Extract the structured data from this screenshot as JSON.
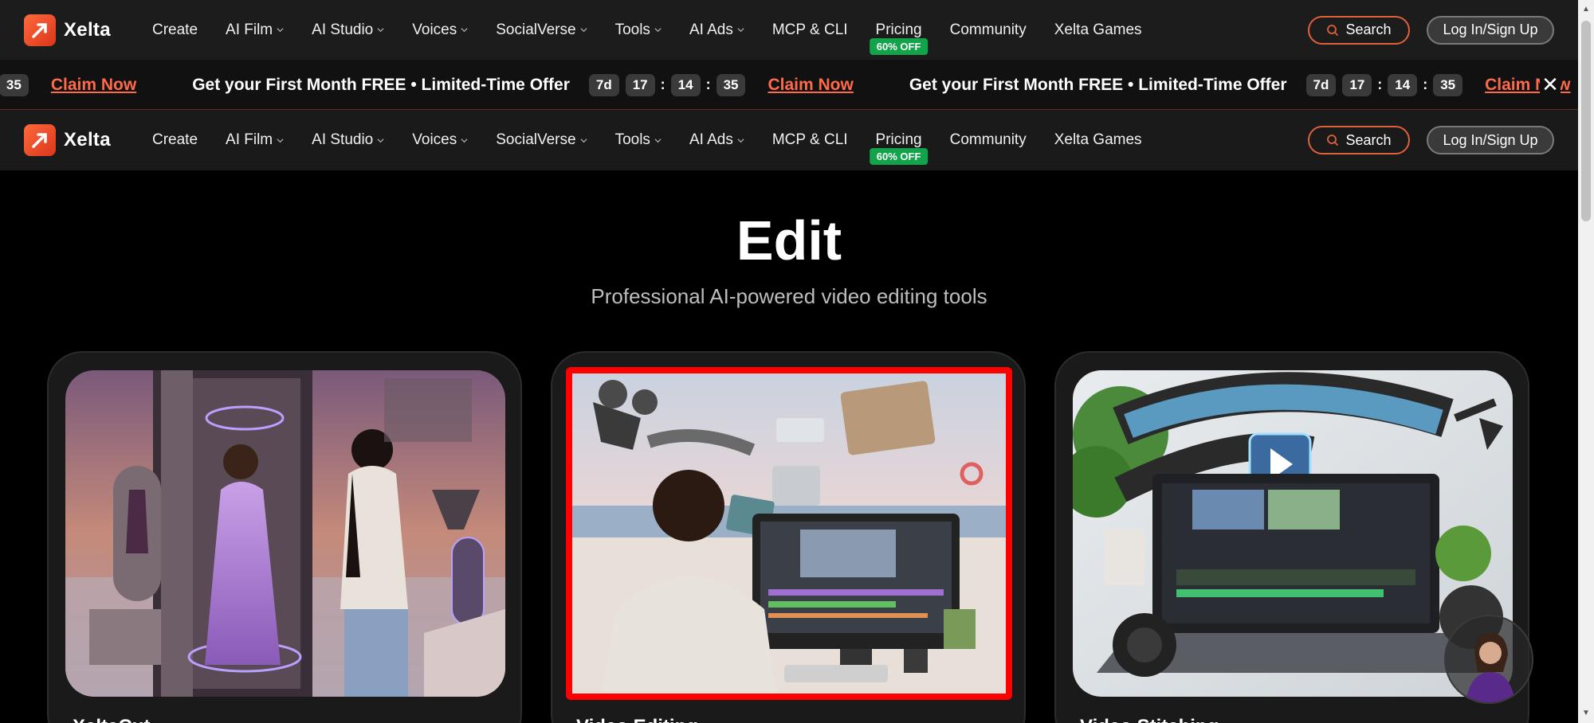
{
  "brand": {
    "name": "Xelta"
  },
  "nav": {
    "items": [
      {
        "label": "Create",
        "dropdown": false
      },
      {
        "label": "AI Film",
        "dropdown": true
      },
      {
        "label": "AI Studio",
        "dropdown": true
      },
      {
        "label": "Voices",
        "dropdown": true
      },
      {
        "label": "SocialVerse",
        "dropdown": true
      },
      {
        "label": "Tools",
        "dropdown": true
      },
      {
        "label": "AI Ads",
        "dropdown": true
      },
      {
        "label": "MCP & CLI",
        "dropdown": false
      },
      {
        "label": "Pricing",
        "dropdown": false
      },
      {
        "label": "Community",
        "dropdown": false
      },
      {
        "label": "Xelta Games",
        "dropdown": false
      }
    ],
    "pricing_badge": "60% OFF",
    "search_label": "Search",
    "login_label": "Log In/Sign Up"
  },
  "promo": {
    "text": "Get your First Month FREE • Limited-Time Offer",
    "timer": {
      "days": "7d",
      "hours": "17",
      "minutes": "14",
      "seconds": "35"
    },
    "claim_label": "Claim Now",
    "close_glyph": "✕"
  },
  "hero": {
    "title": "Edit",
    "subtitle": "Professional AI-powered video editing tools"
  },
  "cards": [
    {
      "title": "XeltaCut"
    },
    {
      "title": "Video Editing"
    },
    {
      "title": "Video Stitching"
    }
  ],
  "colors": {
    "accent": "#ff6b4a",
    "badge_green": "#13a34a",
    "selection_red": "#ff0000"
  }
}
